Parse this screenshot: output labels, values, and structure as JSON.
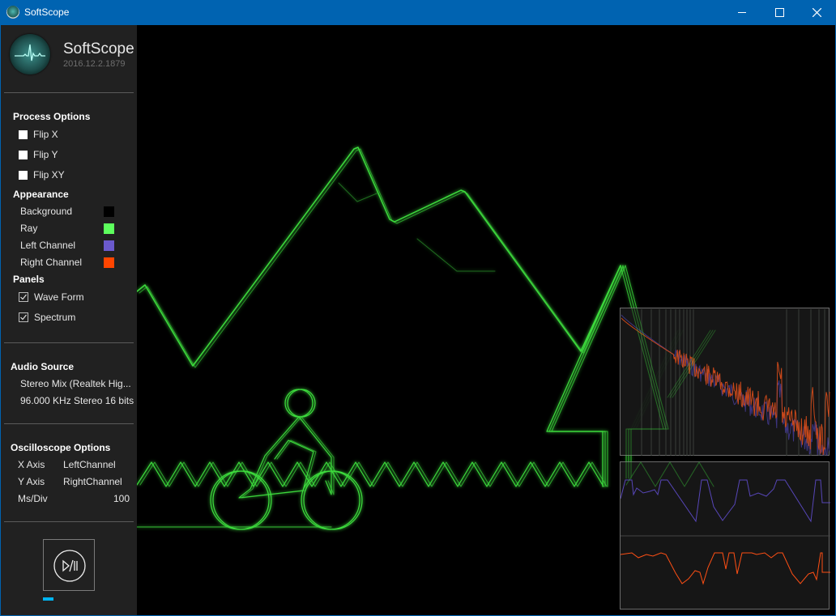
{
  "window": {
    "title": "SoftScope",
    "controls": [
      "minimize",
      "maximize",
      "close"
    ]
  },
  "app": {
    "name": "SoftScope",
    "version": "2016.12.2.1879",
    "logo_icon": "heartbeat-scope-icon"
  },
  "process_options": {
    "title": "Process Options",
    "items": [
      {
        "label": "Flip X",
        "checked": false
      },
      {
        "label": "Flip Y",
        "checked": false
      },
      {
        "label": "Flip XY",
        "checked": false
      }
    ]
  },
  "appearance": {
    "title": "Appearance",
    "items": [
      {
        "label": "Background",
        "color": "#000000"
      },
      {
        "label": "Ray",
        "color": "#5dff5d"
      },
      {
        "label": "Left Channel",
        "color": "#6b5acd"
      },
      {
        "label": "Right Channel",
        "color": "#ff4500"
      }
    ]
  },
  "panels": {
    "title": "Panels",
    "items": [
      {
        "label": "Wave Form",
        "checked": true
      },
      {
        "label": "Spectrum",
        "checked": true
      }
    ]
  },
  "audio_source": {
    "title": "Audio Source",
    "device": "Stereo Mix (Realtek Hig...",
    "format": "96.000 KHz Stereo 16 bits"
  },
  "oscilloscope_options": {
    "title": "Oscilloscope Options",
    "rows": [
      {
        "key": "X Axis",
        "value": "LeftChannel"
      },
      {
        "key": "Y Axis",
        "value": "RightChannel"
      },
      {
        "key": "Ms/Div",
        "value": "100"
      }
    ]
  },
  "playback": {
    "button_icon": "play-pause-icon",
    "progress_fraction": 0.02
  },
  "colors": {
    "titlebar": "#0063b1",
    "sidebar": "#212121",
    "ray": "#3ddc3d",
    "left_channel": "#5746b8",
    "right_channel": "#ff4f14",
    "progress": "#00b4f0"
  },
  "scene": {
    "description": "XY oscilloscope drawing: mountains, pine tree, cyclist, zigzag grass"
  }
}
